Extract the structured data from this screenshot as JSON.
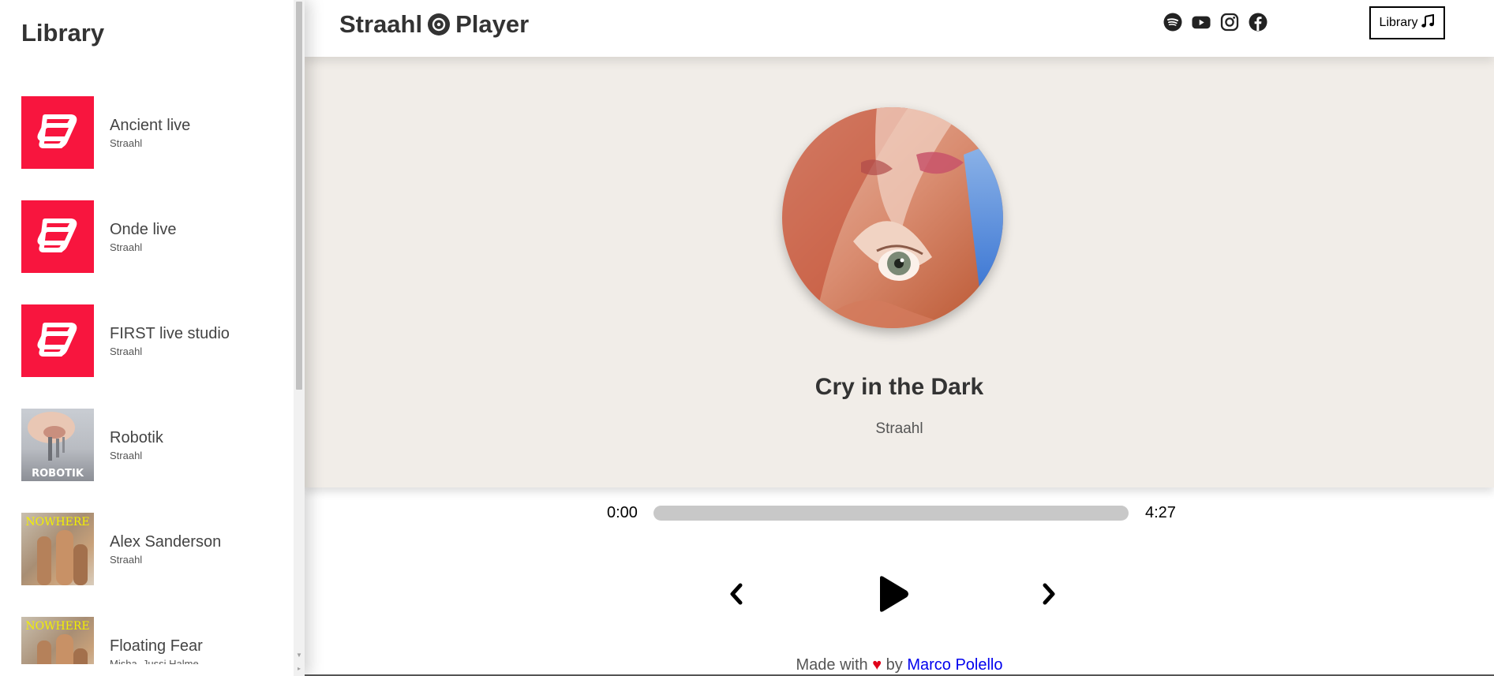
{
  "sidebar": {
    "title": "Library",
    "items": [
      {
        "name": "Ancient live",
        "artist": "Straahl",
        "cover": "straahl-logo"
      },
      {
        "name": "Onde live",
        "artist": "Straahl",
        "cover": "straahl-logo"
      },
      {
        "name": "FIRST live studio",
        "artist": "Straahl",
        "cover": "straahl-logo"
      },
      {
        "name": "Robotik",
        "artist": "Straahl",
        "cover": "robotik-art",
        "cover_text": "ROBOTIK"
      },
      {
        "name": "Alex Sanderson",
        "artist": "Straahl",
        "cover": "nowhere-art",
        "cover_text": "NOWHERE"
      },
      {
        "name": "Floating Fear",
        "artist": "Misha, Jussi Halme",
        "cover": "nowhere-art",
        "cover_text": "NOWHERE"
      }
    ]
  },
  "header": {
    "brand_left": "Straahl",
    "brand_icon": "vinyl-disc-icon",
    "brand_right": "Player",
    "socials": [
      "spotify-icon",
      "youtube-icon",
      "instagram-icon",
      "facebook-icon"
    ],
    "library_button": "Library",
    "library_button_icon": "music-note-icon"
  },
  "now_playing": {
    "title": "Cry in the Dark",
    "artist": "Straahl"
  },
  "player": {
    "current_time": "0:00",
    "total_time": "4:27",
    "progress": 0,
    "controls": [
      "prev-icon",
      "play-icon",
      "next-icon"
    ]
  },
  "footer": {
    "prefix": "Made with",
    "heart": "♥",
    "by": "by",
    "author": "Marco Polello"
  },
  "colors": {
    "accent_red": "#f8153e",
    "hero_bg": "#f1ede8",
    "progress_track": "#c8c8c8",
    "link": "#0000ee",
    "heart": "#e0001a"
  }
}
